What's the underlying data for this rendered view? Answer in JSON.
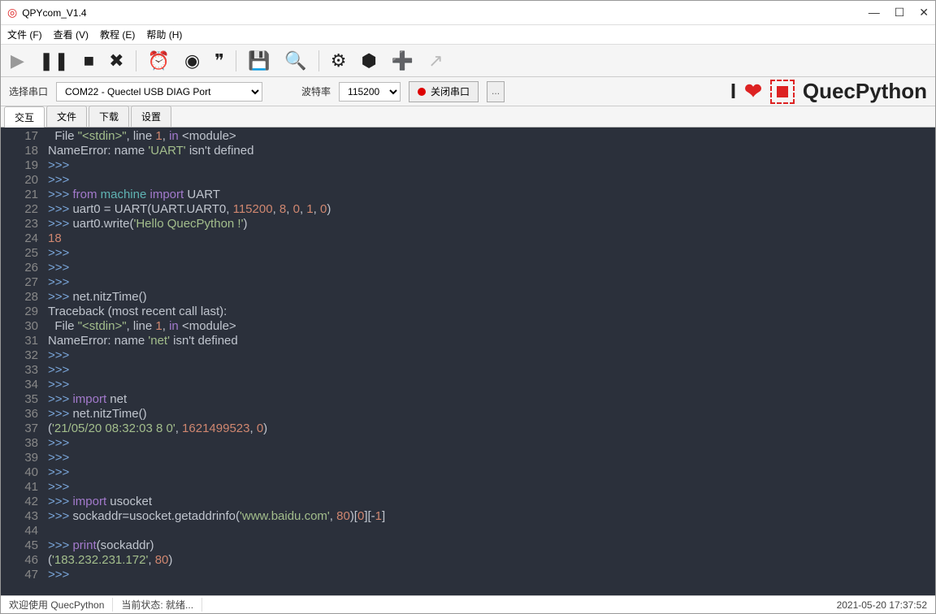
{
  "window": {
    "title": "QPYcom_V1.4"
  },
  "menu": {
    "file": "文件 (F)",
    "view": "查看 (V)",
    "tutorial": "教程 (E)",
    "help": "帮助 (H)"
  },
  "portrow": {
    "serial_label": "选择串口",
    "serial_value": "COM22 - Quectel USB DIAG Port",
    "baud_label": "波特率",
    "baud_value": "115200",
    "close_port": "关闭串口"
  },
  "brand": {
    "i": "I",
    "name": "QuecPython"
  },
  "tabs": [
    "交互",
    "文件",
    "下载",
    "设置"
  ],
  "status": {
    "welcome": "欢迎使用 QuecPython",
    "state": "当前状态: 就绪...",
    "time": "2021-05-20 17:37:52"
  },
  "lines": [
    {
      "n": 17,
      "seg": [
        {
          "t": "  File ",
          "c": ""
        },
        {
          "t": "\"<stdin>\"",
          "c": "str"
        },
        {
          "t": ", line ",
          "c": ""
        },
        {
          "t": "1",
          "c": "num"
        },
        {
          "t": ", ",
          "c": ""
        },
        {
          "t": "in",
          "c": "kw"
        },
        {
          "t": " <module>",
          "c": ""
        }
      ]
    },
    {
      "n": 18,
      "seg": [
        {
          "t": "NameError: name ",
          "c": ""
        },
        {
          "t": "'UART'",
          "c": "str"
        },
        {
          "t": " isn't defined",
          "c": ""
        }
      ]
    },
    {
      "n": 19,
      "seg": [
        {
          "t": ">>>",
          "c": "prompt"
        }
      ]
    },
    {
      "n": 20,
      "seg": [
        {
          "t": ">>>",
          "c": "prompt"
        }
      ]
    },
    {
      "n": 21,
      "seg": [
        {
          "t": ">>> ",
          "c": "prompt"
        },
        {
          "t": "from",
          "c": "kw"
        },
        {
          "t": " machine ",
          "c": "fn"
        },
        {
          "t": "import",
          "c": "kw"
        },
        {
          "t": " UART",
          "c": ""
        }
      ]
    },
    {
      "n": 22,
      "seg": [
        {
          "t": ">>> ",
          "c": "prompt"
        },
        {
          "t": "uart0 = UART(UART.UART0, ",
          "c": ""
        },
        {
          "t": "115200",
          "c": "num"
        },
        {
          "t": ", ",
          "c": ""
        },
        {
          "t": "8",
          "c": "num"
        },
        {
          "t": ", ",
          "c": ""
        },
        {
          "t": "0",
          "c": "num"
        },
        {
          "t": ", ",
          "c": ""
        },
        {
          "t": "1",
          "c": "num"
        },
        {
          "t": ", ",
          "c": ""
        },
        {
          "t": "0",
          "c": "num"
        },
        {
          "t": ")",
          "c": ""
        }
      ]
    },
    {
      "n": 23,
      "seg": [
        {
          "t": ">>> ",
          "c": "prompt"
        },
        {
          "t": "uart0.write(",
          "c": ""
        },
        {
          "t": "'Hello QuecPython !'",
          "c": "str"
        },
        {
          "t": ")",
          "c": ""
        }
      ]
    },
    {
      "n": 24,
      "seg": [
        {
          "t": "18",
          "c": "num"
        }
      ]
    },
    {
      "n": 25,
      "seg": [
        {
          "t": ">>>",
          "c": "prompt"
        }
      ]
    },
    {
      "n": 26,
      "seg": [
        {
          "t": ">>>",
          "c": "prompt"
        }
      ]
    },
    {
      "n": 27,
      "seg": [
        {
          "t": ">>>",
          "c": "prompt"
        }
      ]
    },
    {
      "n": 28,
      "seg": [
        {
          "t": ">>> ",
          "c": "prompt"
        },
        {
          "t": "net.nitzTime()",
          "c": ""
        }
      ]
    },
    {
      "n": 29,
      "seg": [
        {
          "t": "Traceback (most recent call last):",
          "c": ""
        }
      ]
    },
    {
      "n": 30,
      "seg": [
        {
          "t": "  File ",
          "c": ""
        },
        {
          "t": "\"<stdin>\"",
          "c": "str"
        },
        {
          "t": ", line ",
          "c": ""
        },
        {
          "t": "1",
          "c": "num"
        },
        {
          "t": ", ",
          "c": ""
        },
        {
          "t": "in",
          "c": "kw"
        },
        {
          "t": " <module>",
          "c": ""
        }
      ]
    },
    {
      "n": 31,
      "seg": [
        {
          "t": "NameError: name ",
          "c": ""
        },
        {
          "t": "'net'",
          "c": "str"
        },
        {
          "t": " isn't defined",
          "c": ""
        }
      ]
    },
    {
      "n": 32,
      "seg": [
        {
          "t": ">>>",
          "c": "prompt"
        }
      ]
    },
    {
      "n": 33,
      "seg": [
        {
          "t": ">>>",
          "c": "prompt"
        }
      ]
    },
    {
      "n": 34,
      "seg": [
        {
          "t": ">>>",
          "c": "prompt"
        }
      ]
    },
    {
      "n": 35,
      "seg": [
        {
          "t": ">>> ",
          "c": "prompt"
        },
        {
          "t": "import",
          "c": "kw"
        },
        {
          "t": " net",
          "c": ""
        }
      ]
    },
    {
      "n": 36,
      "seg": [
        {
          "t": ">>> ",
          "c": "prompt"
        },
        {
          "t": "net.nitzTime()",
          "c": ""
        }
      ]
    },
    {
      "n": 37,
      "seg": [
        {
          "t": "(",
          "c": ""
        },
        {
          "t": "'21/05/20 08:32:03 8 0'",
          "c": "str"
        },
        {
          "t": ", ",
          "c": ""
        },
        {
          "t": "1621499523",
          "c": "num"
        },
        {
          "t": ", ",
          "c": ""
        },
        {
          "t": "0",
          "c": "num"
        },
        {
          "t": ")",
          "c": ""
        }
      ]
    },
    {
      "n": 38,
      "seg": [
        {
          "t": ">>>",
          "c": "prompt"
        }
      ]
    },
    {
      "n": 39,
      "seg": [
        {
          "t": ">>>",
          "c": "prompt"
        }
      ]
    },
    {
      "n": 40,
      "seg": [
        {
          "t": ">>>",
          "c": "prompt"
        }
      ]
    },
    {
      "n": 41,
      "seg": [
        {
          "t": ">>>",
          "c": "prompt"
        }
      ]
    },
    {
      "n": 42,
      "seg": [
        {
          "t": ">>> ",
          "c": "prompt"
        },
        {
          "t": "import",
          "c": "kw"
        },
        {
          "t": " usocket",
          "c": ""
        }
      ]
    },
    {
      "n": 43,
      "seg": [
        {
          "t": ">>> ",
          "c": "prompt"
        },
        {
          "t": "sockaddr=usocket.getaddrinfo(",
          "c": ""
        },
        {
          "t": "'www.baidu.com'",
          "c": "str"
        },
        {
          "t": ", ",
          "c": ""
        },
        {
          "t": "80",
          "c": "num"
        },
        {
          "t": ")[",
          "c": ""
        },
        {
          "t": "0",
          "c": "num"
        },
        {
          "t": "][-",
          "c": ""
        },
        {
          "t": "1",
          "c": "num"
        },
        {
          "t": "]",
          "c": ""
        }
      ]
    },
    {
      "n": 44,
      "seg": [
        {
          "t": "",
          "c": ""
        }
      ]
    },
    {
      "n": 45,
      "seg": [
        {
          "t": ">>> ",
          "c": "prompt"
        },
        {
          "t": "print",
          "c": "kw"
        },
        {
          "t": "(sockaddr)",
          "c": ""
        }
      ]
    },
    {
      "n": 46,
      "seg": [
        {
          "t": "(",
          "c": ""
        },
        {
          "t": "'183.232.231.172'",
          "c": "str"
        },
        {
          "t": ", ",
          "c": ""
        },
        {
          "t": "80",
          "c": "num"
        },
        {
          "t": ")",
          "c": ""
        }
      ]
    },
    {
      "n": 47,
      "seg": [
        {
          "t": ">>>",
          "c": "prompt"
        }
      ]
    }
  ]
}
